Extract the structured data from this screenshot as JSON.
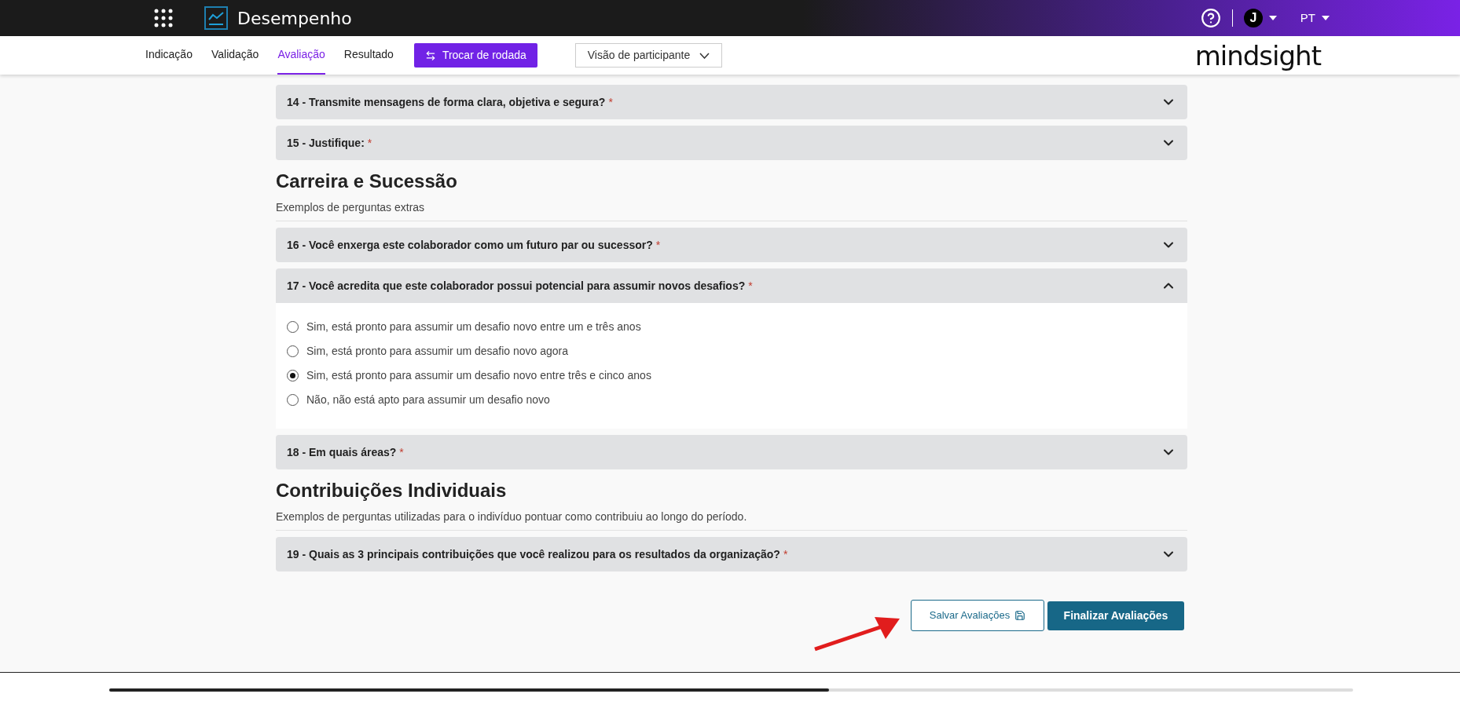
{
  "header": {
    "app_title": "Desempenho",
    "avatar_initial": "J",
    "language": "PT"
  },
  "nav": {
    "tabs": [
      {
        "label": "Indicação",
        "selected": false
      },
      {
        "label": "Validação",
        "selected": false
      },
      {
        "label": "Avaliação",
        "selected": true
      },
      {
        "label": "Resultado",
        "selected": false
      }
    ],
    "switch_round_button": "Trocar de rodada",
    "view_select": "Visão de participante",
    "logo": "mindsight"
  },
  "blocks": [
    {
      "kind": "question",
      "label": "14 - Transmite mensagens de forma clara, objetiva e segura?",
      "required_marker": "*",
      "expanded": false
    },
    {
      "kind": "question",
      "label": "15 - Justifique:",
      "required_marker": "*",
      "expanded": false
    },
    {
      "kind": "section",
      "title": "Carreira e Sucessão",
      "description": "Exemplos de perguntas extras"
    },
    {
      "kind": "question",
      "label": "16 - Você enxerga este colaborador como um futuro par ou sucessor?",
      "required_marker": "*",
      "expanded": false
    },
    {
      "kind": "question",
      "label": "17 - Você acredita que este colaborador possui potencial para assumir novos desafios?",
      "required_marker": "*",
      "expanded": true,
      "options": [
        {
          "label": "Sim, está pronto para assumir um desafio novo entre um e três anos",
          "selected": false
        },
        {
          "label": "Sim, está pronto para assumir um desafio novo agora",
          "selected": false
        },
        {
          "label": "Sim, está pronto para assumir um desafio novo entre três e cinco anos",
          "selected": true
        },
        {
          "label": "Não, não está apto para assumir um desafio novo",
          "selected": false
        }
      ]
    },
    {
      "kind": "question",
      "label": "18 - Em quais áreas?",
      "required_marker": "*",
      "expanded": false
    },
    {
      "kind": "section",
      "title": "Contribuições Individuais",
      "description": "Exemplos de perguntas utilizadas para o indivíduo pontuar como contribuiu ao longo do período."
    },
    {
      "kind": "question",
      "label": "19 - Quais as 3 principais contribuições que você realizou para os resultados da organização?",
      "required_marker": "*",
      "expanded": false
    }
  ],
  "actions": {
    "save_button": "Salvar Avaliações",
    "finish_button": "Finalizar Avaliações"
  }
}
